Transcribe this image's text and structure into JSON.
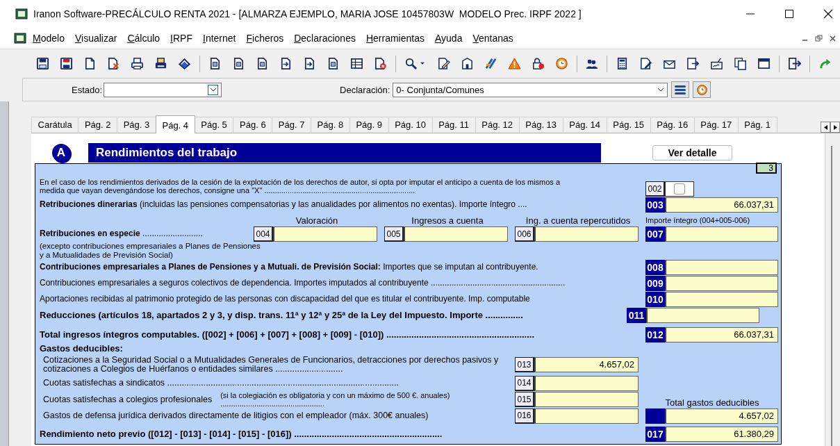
{
  "window": {
    "title": "Iranon Software-PRECÁLCULO RENTA 2021 - [ALMARZA EJEMPLO, MARIA JOSE 10457803W  MODELO Prec. IRPF 2022 ]"
  },
  "menu": [
    "Modelo",
    "Visualizar",
    "Cálculo",
    "IRPF",
    "Internet",
    "Ficheros",
    "Declaraciones",
    "Herramientas",
    "Ayuda",
    "Ventanas"
  ],
  "filters": {
    "estado_label": "Estado:",
    "declaracion_label": "Declaración:",
    "declaracion_value": "0- Conjunta/Comunes"
  },
  "tabs": [
    {
      "label": "Carátula",
      "selected": false
    },
    {
      "label": "Pág. 2",
      "selected": false
    },
    {
      "label": "Pág. 3",
      "selected": false
    },
    {
      "label": "Pág. 4",
      "selected": true
    },
    {
      "label": "Pág. 5",
      "selected": false
    },
    {
      "label": "Pág. 6",
      "selected": false
    },
    {
      "label": "Pág. 7",
      "selected": false
    },
    {
      "label": "Pág. 8",
      "selected": false
    },
    {
      "label": "Pág. 9",
      "selected": false
    },
    {
      "label": "Pág. 10",
      "selected": false
    },
    {
      "label": "Pág. 11",
      "selected": false
    },
    {
      "label": "Pág. 12",
      "selected": false
    },
    {
      "label": "Pág. 13",
      "selected": false
    },
    {
      "label": "Pág. 14",
      "selected": false
    },
    {
      "label": "Pág. 15",
      "selected": false
    },
    {
      "label": "Pág. 16",
      "selected": false
    },
    {
      "label": "Pág. 17",
      "selected": false
    },
    {
      "label": "Pág. 1",
      "selected": false
    }
  ],
  "section": {
    "letter": "A",
    "title": "Rendimientos del trabajo",
    "detail_button": "Ver detalle",
    "page_badge": "3"
  },
  "rows": [
    {
      "kind": "checkbox",
      "text": "En el caso de los rendimientos derivados de la cesión de la explotación de los derechos de autor, si opta por imputar el anticipo a cuenta de los mismos a medida que vayan devengándose los derechos, consigne una \"X\" .......................................................................",
      "code": "002",
      "checked": false
    },
    {
      "kind": "line",
      "label": "**Retribuciones dinerarias** (incluidas las pensiones compensatorias y las anualidades por alimentos no exentas). Importe íntegro ....",
      "code": "003",
      "value": "66.037,31"
    },
    {
      "kind": "species",
      "headings": [
        "Valoración",
        "Ingresos a cuenta",
        "Ing. a cuenta repercutidos"
      ],
      "result_heading": "Importe íntegro (004+005-006)",
      "label": "**Retribuciones en especie** ..........................",
      "note": "(excepto contribuciones empresariales a Planes de Pensiones y a Mutualidades de Previsión Social)",
      "inputs": [
        {
          "code": "004"
        },
        {
          "code": "005"
        },
        {
          "code": "006"
        }
      ],
      "code": "007"
    },
    {
      "kind": "line",
      "label": "**Contribuciones empresariales a Planes de Pensiones y a Mutuali. de Previsión Social:** Importes que se imputan al contribuyente.",
      "code": "008"
    },
    {
      "kind": "line",
      "label": "Contribuciones empresariales a seguros colectivos de dependencia. Importes imputados al contribuyente ..........................................................",
      "code": "009"
    },
    {
      "kind": "line",
      "label": "Aportaciones recibidas al patrimonio protegido de las personas con discapacidad del que es titular el contribuyente. Imp. computable",
      "code": "010"
    },
    {
      "kind": "reduction",
      "label": "Reducciones (artículos 18, apartados 2 y 3, y disp. trans.  11ª y 12ª y 25ª de la Ley del Impuesto. Importe ...............",
      "code": "011"
    },
    {
      "kind": "total",
      "label": "Total ingresos íntegros computables. ([002] + [006] + [007] + [008] + [009] - [010]) ...........................................................",
      "code": "012",
      "value": "66.037,31"
    },
    {
      "kind": "heading",
      "label": "Gastos deducibles:"
    },
    {
      "kind": "expense",
      "label": "Cotizaciones a la Seguridad Social o a Mutualidades Generales de Funcionarios, detracciones por derechos pasivos y cotizaciones a Colegios de Huérfanos o entidades similares ............................",
      "code": "013",
      "value": "4.657,02"
    },
    {
      "kind": "expense",
      "label": "Cuotas satisfechas a sindicatos ................................................................................................",
      "code": "014"
    },
    {
      "kind": "expense",
      "label": "Cuotas satisfechas a colegios profesionales",
      "note": "(si la colegiación es obligatoria y con un máximo de 500 €. anuales) .................................................",
      "code": "015",
      "total_heading": "Total gastos deducibles"
    },
    {
      "kind": "expense",
      "label": "Gastos de defensa jurídica derivados directamente de litigios con el empleador (máx. 300€ anuales)",
      "code": "016",
      "total_value": "4.657,02"
    },
    {
      "kind": "total",
      "label": "Rendimiento neto previo ([012] - [013] - [014] - [015] - [016]) ...........................................................",
      "code": "017",
      "value": "61.380,29"
    }
  ]
}
